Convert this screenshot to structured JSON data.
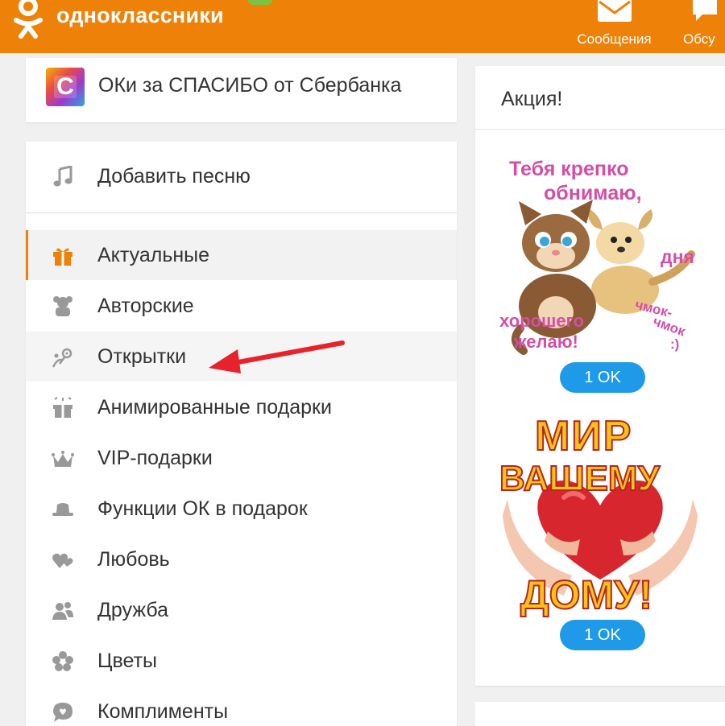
{
  "header": {
    "logo_text": "одноклассники",
    "messages_label": "Сообщения",
    "discussions_label": "Обсу"
  },
  "promo": {
    "icon_letter": "C",
    "text": "ОКи за СПАСИБО от Сбербанка"
  },
  "menu": {
    "items": [
      {
        "label": "Добавить песню",
        "icon": "music-note-icon"
      },
      {
        "label": "Актуальные",
        "icon": "gift-icon"
      },
      {
        "label": "Авторские",
        "icon": "teddy-bear-icon"
      },
      {
        "label": "Открытки",
        "icon": "postcard-icon"
      },
      {
        "label": "Анимированные подарки",
        "icon": "animated-gift-icon"
      },
      {
        "label": "VIP-подарки",
        "icon": "crown-icon"
      },
      {
        "label": "Функции ОК в подарок",
        "icon": "hat-icon"
      },
      {
        "label": "Любовь",
        "icon": "hearts-icon"
      },
      {
        "label": "Дружба",
        "icon": "friends-icon"
      },
      {
        "label": "Цветы",
        "icon": "flower-icon"
      },
      {
        "label": "Комплименты",
        "icon": "speech-bubble-icon"
      }
    ]
  },
  "promo_panel": {
    "title": "Акция!",
    "gifts": [
      {
        "lines": [
          "Тебя крепко",
          "обнимаю,",
          "дня",
          "хорошего",
          "желаю!",
          "чмок-",
          "чмок",
          ":)"
        ],
        "price": "1 OK"
      },
      {
        "lines": [
          "МИР",
          "ВАШЕМУ",
          "ДОМУ!"
        ],
        "price": "1 OK"
      }
    ]
  },
  "colors": {
    "brand_orange": "#ee8208",
    "price_blue": "#1e9ae8",
    "arrow_red": "#e8222a"
  }
}
